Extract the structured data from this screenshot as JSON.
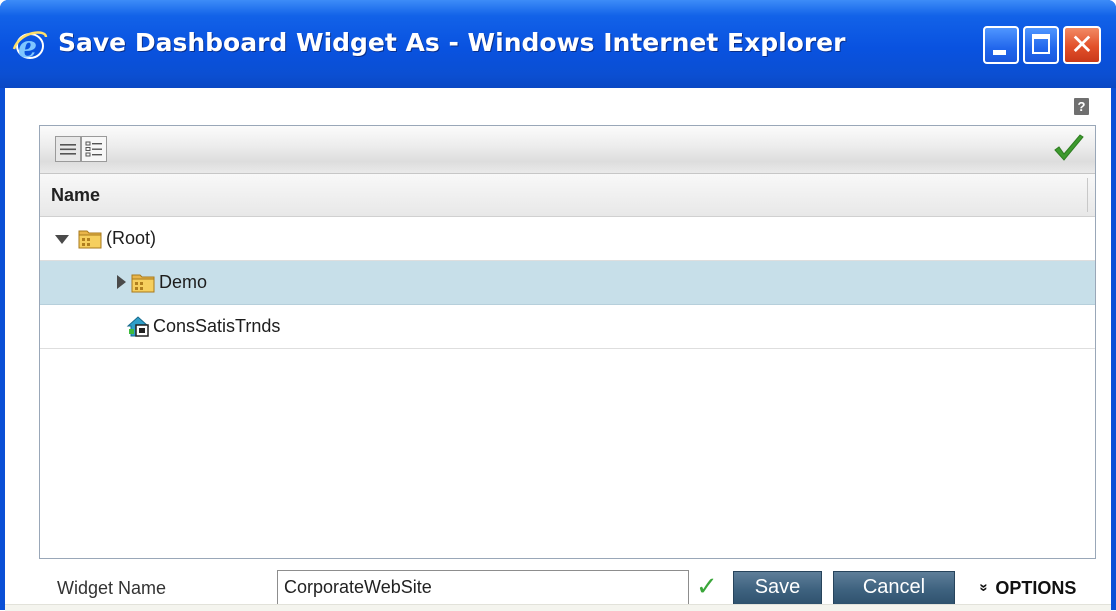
{
  "window": {
    "title": "Save Dashboard Widget As - Windows Internet Explorer",
    "controls": [
      "minimize",
      "maximize",
      "close"
    ],
    "app_icon": "internet-explorer-icon"
  },
  "toolbar": {
    "help_label": "?",
    "view_buttons": [
      "list-view-icon",
      "detail-view-icon"
    ],
    "confirm_icon": "checkmark-icon"
  },
  "tree": {
    "column_header": "Name",
    "items": [
      {
        "label": "(Root)",
        "icon": "folder-icon",
        "expanded": true,
        "level": 0,
        "selected": false
      },
      {
        "label": "Demo",
        "icon": "folder-icon",
        "expanded": false,
        "level": 1,
        "selected": true
      },
      {
        "label": "ConsSatisTrnds",
        "icon": "dashboard-widget-icon",
        "level": 1,
        "selected": false
      }
    ]
  },
  "form": {
    "widget_name_label": "Widget Name",
    "widget_name_value": "CorporateWebSite",
    "valid_mark": "✓",
    "save_label": "Save",
    "cancel_label": "Cancel",
    "options_chevron": "»",
    "options_label": "OPTIONS"
  },
  "colors": {
    "titlebar": "#0952e0",
    "selected_row": "#c7dfe9",
    "button": "#3e627f",
    "valid_green": "#3aa63a"
  }
}
